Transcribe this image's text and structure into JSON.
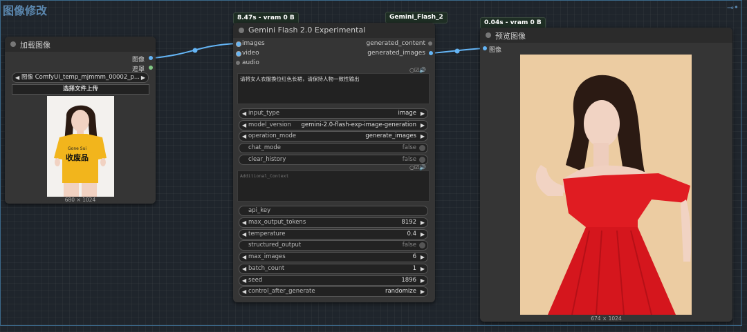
{
  "group": {
    "title": "图像修改"
  },
  "load_node": {
    "title": "加载图像",
    "outputs": [
      "图像",
      "遮罩"
    ],
    "image_select": {
      "label": "图像",
      "value": "ComfyUI_temp_mjmmm_00002_p..."
    },
    "upload_button": "选择文件上传",
    "caption": "680 × 1024",
    "shirt_text": [
      "Gone Sui",
      "收废品"
    ]
  },
  "gemini_node": {
    "title": "Gemini Flash 2.0 Experimental",
    "badge_time": "8.47s - vram 0 B",
    "badge_name": "Gemini_Flash_2",
    "inputs": [
      "images",
      "video",
      "audio"
    ],
    "outputs": [
      "generated_content",
      "generated_images"
    ],
    "prompt_text": "请将女人衣服换位红色长裙，请保持人物一致性输出",
    "context_placeholder": "Additional_Context",
    "widgets": [
      {
        "name": "input_type",
        "value": "image",
        "kind": "combo"
      },
      {
        "name": "model_version",
        "value": "gemini-2.0-flash-exp-image-generation",
        "kind": "combo"
      },
      {
        "name": "operation_mode",
        "value": "generate_images",
        "kind": "combo"
      },
      {
        "name": "chat_mode",
        "value": "false",
        "kind": "toggle"
      },
      {
        "name": "clear_history",
        "value": "false",
        "kind": "toggle"
      }
    ],
    "widgets2": [
      {
        "name": "api_key",
        "value": "",
        "kind": "text"
      },
      {
        "name": "max_output_tokens",
        "value": "8192",
        "kind": "combo"
      },
      {
        "name": "temperature",
        "value": "0.4",
        "kind": "combo"
      },
      {
        "name": "structured_output",
        "value": "false",
        "kind": "toggle"
      },
      {
        "name": "max_images",
        "value": "6",
        "kind": "combo"
      },
      {
        "name": "batch_count",
        "value": "1",
        "kind": "combo"
      },
      {
        "name": "seed",
        "value": "1896",
        "kind": "combo"
      },
      {
        "name": "control_after_generate",
        "value": "randomize",
        "kind": "combo"
      }
    ]
  },
  "preview_node": {
    "title": "预览图像",
    "badge_time": "0.04s - vram 0 B",
    "input": "图像",
    "caption": "674 × 1024"
  },
  "colors": {
    "image_link": "#64b5f6",
    "mask_socket": "#81c784",
    "shirt": "#f2b51c",
    "dress": "#e01c22"
  }
}
